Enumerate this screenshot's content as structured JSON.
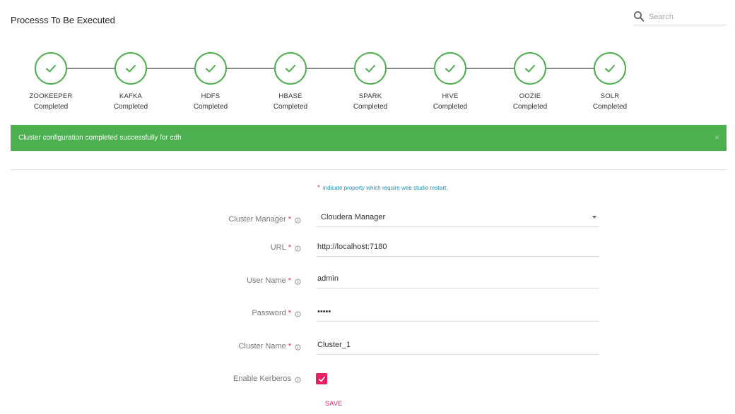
{
  "page": {
    "title": "Processs To Be Executed"
  },
  "search": {
    "placeholder": "Search",
    "icon": "search-icon"
  },
  "steps": [
    {
      "name": "ZOOKEEPER",
      "status": "Completed"
    },
    {
      "name": "KAFKA",
      "status": "Completed"
    },
    {
      "name": "HDFS",
      "status": "Completed"
    },
    {
      "name": "HBASE",
      "status": "Completed"
    },
    {
      "name": "SPARK",
      "status": "Completed"
    },
    {
      "name": "HIVE",
      "status": "Completed"
    },
    {
      "name": "OOZIE",
      "status": "Completed"
    },
    {
      "name": "SOLR",
      "status": "Completed"
    }
  ],
  "alert": {
    "message": "Cluster configuration completed successfully for cdh",
    "close": "×"
  },
  "note": {
    "star": "*",
    "text": "indicate property which require web studio restart."
  },
  "form": {
    "cluster_manager": {
      "label": "Cluster Manager",
      "required": "*",
      "value": "Cloudera Manager"
    },
    "url": {
      "label": "URL",
      "required": "*",
      "value": "http://localhost:7180"
    },
    "username": {
      "label": "User Name",
      "required": "*",
      "value": "admin"
    },
    "password": {
      "label": "Password",
      "required": "*",
      "value": "•••••"
    },
    "cluster_name": {
      "label": "Cluster Name",
      "required": "*",
      "value": "Cluster_1"
    },
    "kerberos": {
      "label": "Enable Kerberos",
      "checked": true
    }
  },
  "actions": {
    "save_label": "SAVE"
  },
  "colors": {
    "success": "#4caf50",
    "accent": "#e91e63",
    "link": "#1f8fb3"
  }
}
